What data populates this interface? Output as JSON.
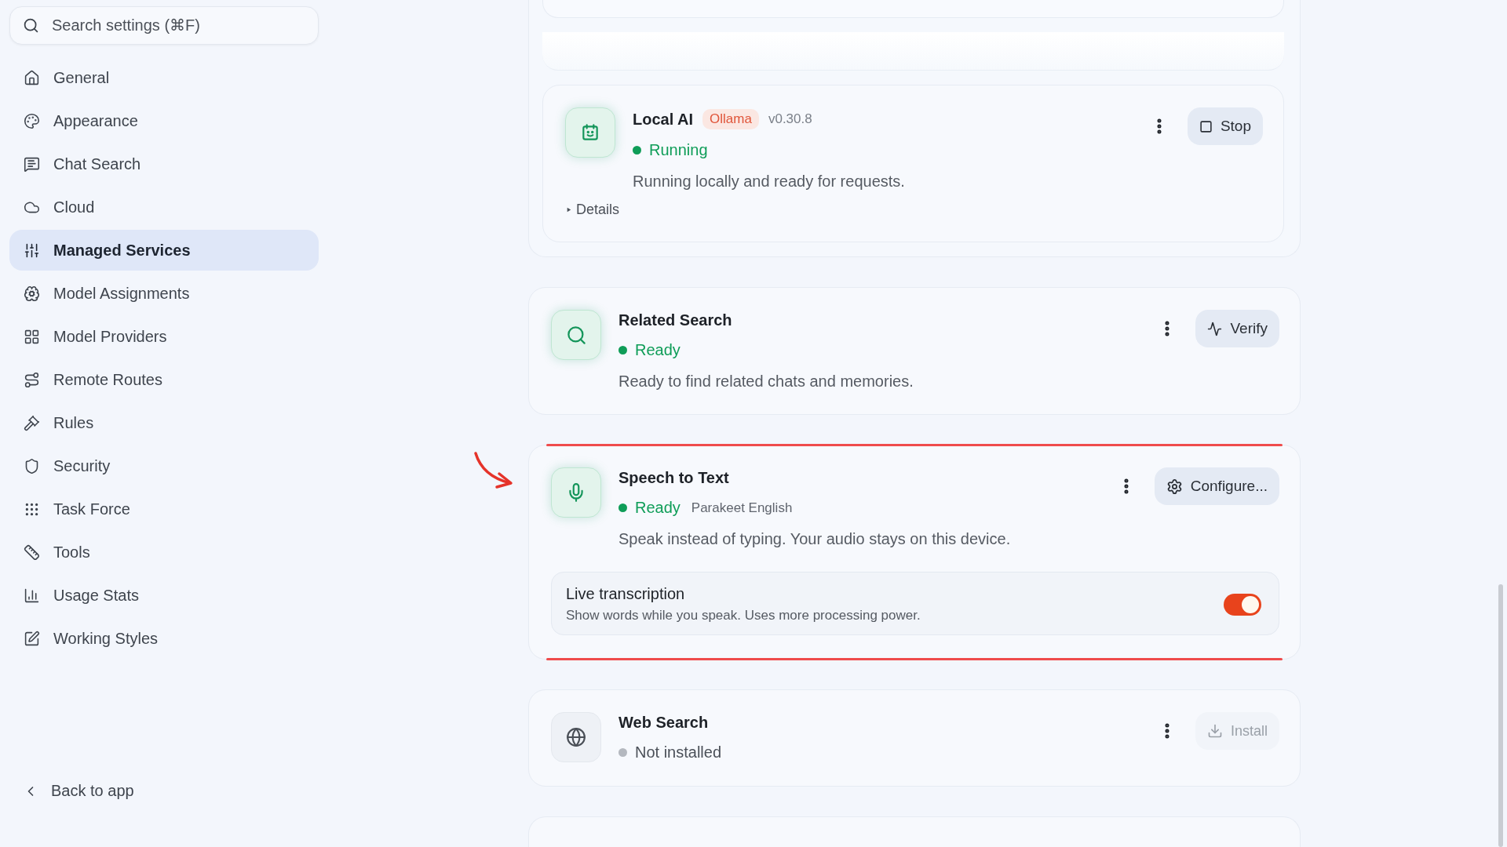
{
  "search": {
    "placeholder": "Search settings (⌘F)"
  },
  "sidebar": {
    "items": [
      {
        "label": "General",
        "selected": false
      },
      {
        "label": "Appearance",
        "selected": false
      },
      {
        "label": "Chat Search",
        "selected": false
      },
      {
        "label": "Cloud",
        "selected": false
      },
      {
        "label": "Managed Services",
        "selected": true
      },
      {
        "label": "Model Assignments",
        "selected": false
      },
      {
        "label": "Model Providers",
        "selected": false
      },
      {
        "label": "Remote Routes",
        "selected": false
      },
      {
        "label": "Rules",
        "selected": false
      },
      {
        "label": "Security",
        "selected": false
      },
      {
        "label": "Task Force",
        "selected": false
      },
      {
        "label": "Tools",
        "selected": false
      },
      {
        "label": "Usage Stats",
        "selected": false
      },
      {
        "label": "Working Styles",
        "selected": false
      }
    ]
  },
  "back_link": {
    "label": "Back to app"
  },
  "services": [
    {
      "kind": "local_ai",
      "name": "Local AI",
      "badge": "Ollama",
      "version": "v0.30.8",
      "status": {
        "label": "Running",
        "color": "#0f9d58"
      },
      "description": "Running locally and ready for requests.",
      "details": {
        "label": "Details",
        "expanded": false
      },
      "action": {
        "kind": "stop",
        "label": "Stop",
        "disabled": false
      },
      "highlighted": false
    },
    {
      "kind": "search",
      "name": "Related Search",
      "status": {
        "label": "Ready",
        "color": "#0f9d58"
      },
      "description": "Ready to find related chats and memories.",
      "action": {
        "kind": "verify",
        "label": "Verify",
        "disabled": false
      },
      "highlighted": false
    },
    {
      "kind": "speech",
      "name": "Speech to Text",
      "status": {
        "label": "Ready",
        "color": "#0f9d58"
      },
      "detail": "Parakeet English",
      "description": "Speak instead of typing. Your audio stays on this device.",
      "action": {
        "kind": "configure",
        "label": "Configure...",
        "disabled": false
      },
      "setting": {
        "title": "Live transcription",
        "description": "Show words while you speak. Uses more processing power.",
        "on": true
      },
      "highlighted": true
    },
    {
      "kind": "web",
      "name": "Web Search",
      "status": {
        "label": "Not installed",
        "color": "#b4b8bf"
      },
      "action": {
        "kind": "install",
        "label": "Install",
        "disabled": true
      },
      "highlighted": false
    }
  ]
}
